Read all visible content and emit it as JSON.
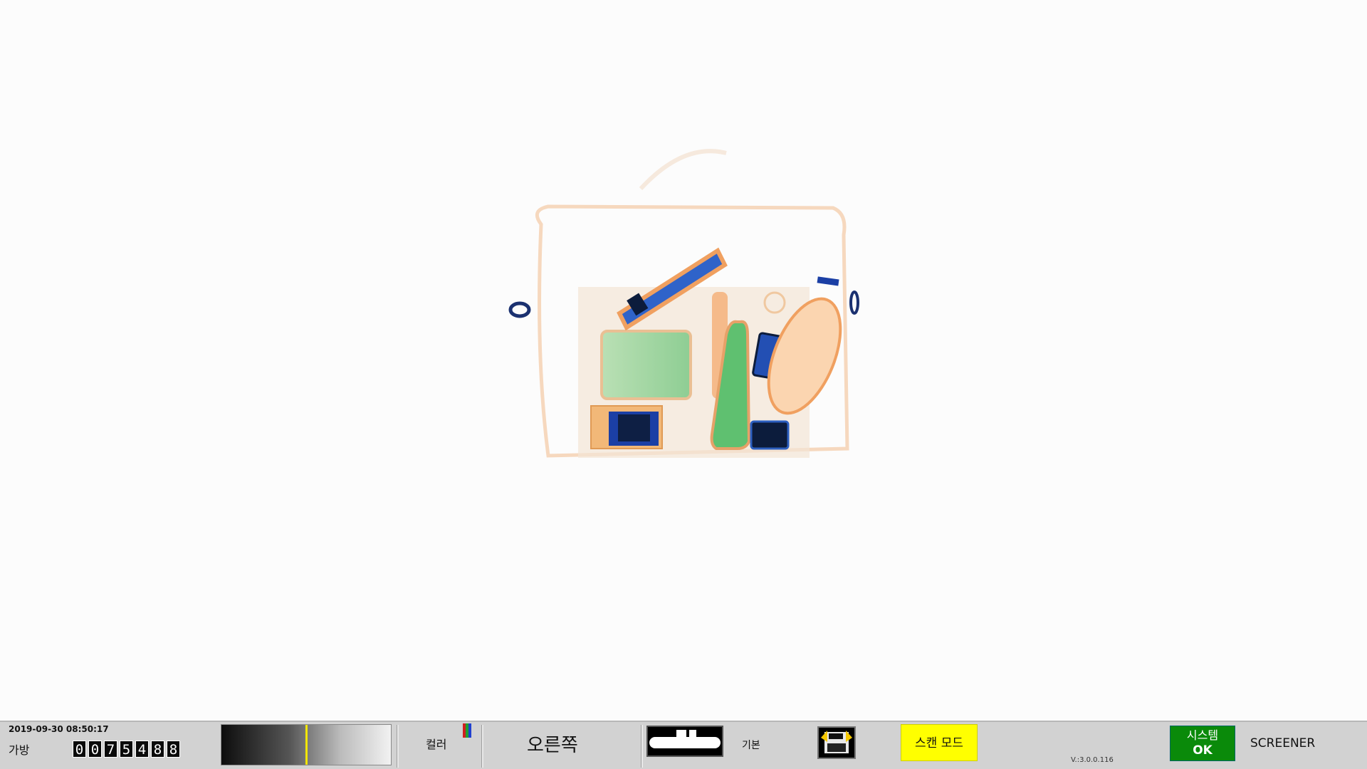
{
  "status_bar": {
    "datetime": "2019-09-30 08:50:17",
    "bag_label": "가방",
    "bag_counter_digits": [
      "0",
      "0",
      "7",
      "5",
      "4",
      "8",
      "8"
    ],
    "color_label": "컬러",
    "direction_label": "오른쪽",
    "basic_label": "기본",
    "scan_mode_label": "스캔 모드",
    "version": "V.:3.0.0.116",
    "system_status_line1": "시스템",
    "system_status_line2": "OK",
    "user_role": "SCREENER"
  },
  "colors": {
    "scan_mode_background": "#ffff00",
    "system_ok_background": "#0a8a0a",
    "gray_marker": "#f2e600",
    "xray_orange": "#f0a060",
    "xray_green": "#70c880",
    "xray_blue": "#2c5fc0",
    "xray_dark": "#0c1c3c"
  },
  "icons": {
    "color_mode": "rgb-bars-icon",
    "conveyor": "conveyor-icon",
    "save": "save-icon"
  }
}
